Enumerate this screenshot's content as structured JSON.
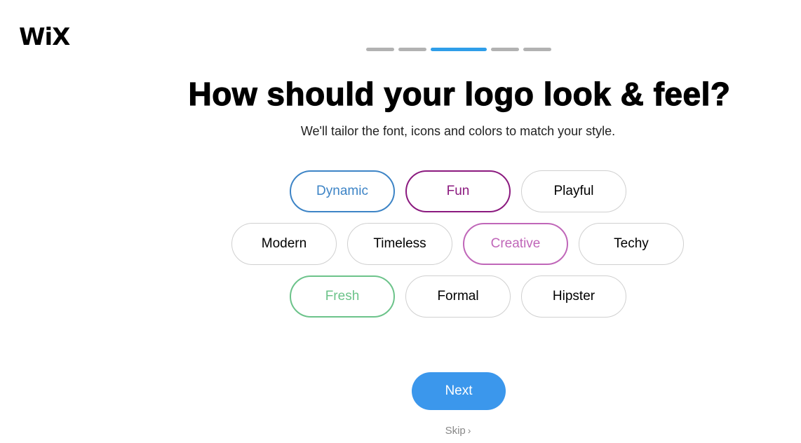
{
  "brand": {
    "logo_text": "WiX"
  },
  "progress": {
    "total_steps": 5,
    "current_step": 3
  },
  "header": {
    "title": "How should your logo look & feel?",
    "subtitle": "We'll tailor the font, icons and colors to match your style."
  },
  "styles": [
    {
      "label": "Dynamic",
      "selected": true,
      "color": "#3d84c6"
    },
    {
      "label": "Fun",
      "selected": true,
      "color": "#8b1a7f"
    },
    {
      "label": "Playful",
      "selected": false,
      "color": "#000000"
    },
    {
      "label": "Modern",
      "selected": false,
      "color": "#000000"
    },
    {
      "label": "Timeless",
      "selected": false,
      "color": "#000000"
    },
    {
      "label": "Creative",
      "selected": true,
      "color": "#c067b9"
    },
    {
      "label": "Techy",
      "selected": false,
      "color": "#000000"
    },
    {
      "label": "Fresh",
      "selected": true,
      "color": "#6cc38a"
    },
    {
      "label": "Formal",
      "selected": false,
      "color": "#000000"
    },
    {
      "label": "Hipster",
      "selected": false,
      "color": "#000000"
    }
  ],
  "actions": {
    "next_label": "Next",
    "next_color": "#3b97ec",
    "skip_label": "Skip",
    "skip_icon": "chevron-right-icon"
  }
}
